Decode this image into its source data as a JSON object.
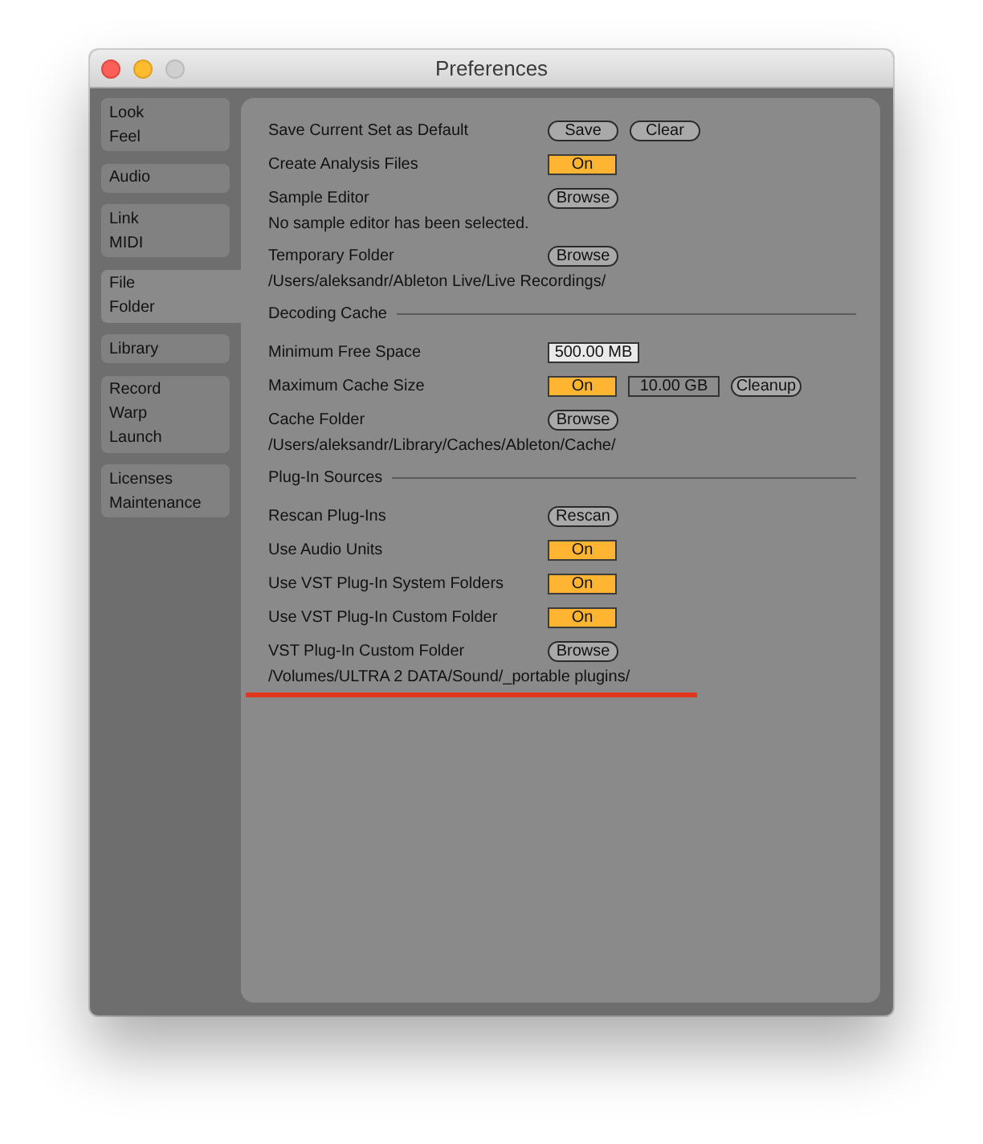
{
  "window": {
    "title": "Preferences",
    "controls": [
      {
        "kind": "close",
        "disabled": false
      },
      {
        "kind": "minimize",
        "disabled": false
      },
      {
        "kind": "zoom",
        "disabled": true
      }
    ]
  },
  "sidebar": {
    "tabs": [
      {
        "lines": [
          "Look",
          "Feel"
        ],
        "selected": false
      },
      {
        "lines": [
          "Audio"
        ],
        "selected": false
      },
      {
        "lines": [
          "Link",
          "MIDI"
        ],
        "selected": false
      },
      {
        "lines": [
          "File",
          "Folder"
        ],
        "selected": true
      },
      {
        "lines": [
          "Library"
        ],
        "selected": false
      },
      {
        "lines": [
          "Record",
          "Warp",
          "Launch"
        ],
        "selected": false
      },
      {
        "lines": [
          "Licenses",
          "Maintenance"
        ],
        "selected": false
      }
    ]
  },
  "settings": [
    {
      "kind": "row",
      "label": "Save Current Set as Default",
      "controls": [
        {
          "kind": "button",
          "label": "Save"
        },
        {
          "kind": "button",
          "label": "Clear"
        }
      ]
    },
    {
      "kind": "row",
      "label": "Create Analysis Files",
      "controls": [
        {
          "kind": "toggle",
          "label": "On",
          "on": true
        }
      ]
    },
    {
      "kind": "row",
      "label": "Sample Editor",
      "controls": [
        {
          "kind": "button",
          "label": "Browse"
        }
      ]
    },
    {
      "kind": "note",
      "text": "No sample editor has been selected.",
      "underlined": false
    },
    {
      "kind": "row",
      "label": "Temporary Folder",
      "controls": [
        {
          "kind": "button",
          "label": "Browse"
        }
      ]
    },
    {
      "kind": "note",
      "text": "/Users/aleksandr/Ableton Live/Live Recordings/",
      "underlined": false
    },
    {
      "kind": "section",
      "title": "Decoding Cache"
    },
    {
      "kind": "row",
      "label": "Minimum Free Space",
      "controls": [
        {
          "kind": "field",
          "value": "500.00 MB",
          "highlighted": true
        }
      ]
    },
    {
      "kind": "row",
      "label": "Maximum Cache Size",
      "controls": [
        {
          "kind": "toggle",
          "label": "On",
          "on": true
        },
        {
          "kind": "field",
          "value": "10.00 GB",
          "highlighted": false
        },
        {
          "kind": "button",
          "label": "Cleanup"
        }
      ]
    },
    {
      "kind": "row",
      "label": "Cache Folder",
      "controls": [
        {
          "kind": "button",
          "label": "Browse"
        }
      ]
    },
    {
      "kind": "note",
      "text": "/Users/aleksandr/Library/Caches/Ableton/Cache/",
      "underlined": false
    },
    {
      "kind": "section",
      "title": "Plug-In Sources"
    },
    {
      "kind": "row",
      "label": "Rescan Plug-Ins",
      "controls": [
        {
          "kind": "button",
          "label": "Rescan"
        }
      ]
    },
    {
      "kind": "row",
      "label": "Use Audio Units",
      "controls": [
        {
          "kind": "toggle",
          "label": "On",
          "on": true
        }
      ]
    },
    {
      "kind": "row",
      "label": "Use VST Plug-In System Folders",
      "controls": [
        {
          "kind": "toggle",
          "label": "On",
          "on": true
        }
      ]
    },
    {
      "kind": "row",
      "label": "Use VST Plug-In Custom Folder",
      "controls": [
        {
          "kind": "toggle",
          "label": "On",
          "on": true
        }
      ]
    },
    {
      "kind": "row",
      "label": "VST Plug-In Custom Folder",
      "controls": [
        {
          "kind": "button",
          "label": "Browse"
        }
      ]
    },
    {
      "kind": "note",
      "text": "/Volumes/ULTRA 2 DATA/Sound/_portable plugins/",
      "underlined": true
    }
  ]
}
